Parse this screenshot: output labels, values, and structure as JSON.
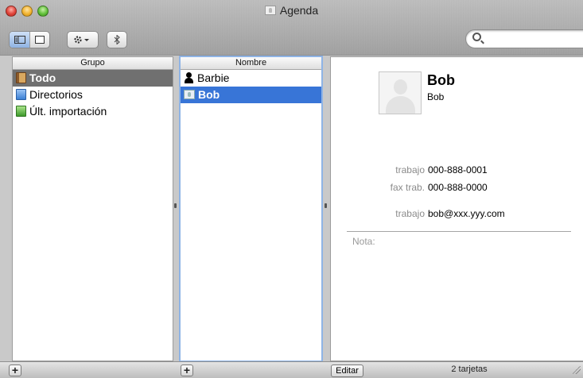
{
  "window": {
    "title": "Agenda"
  },
  "toolbar": {
    "view_columns_icon": "columns-view-icon",
    "view_card_icon": "card-view-icon",
    "action_icon": "gear-menu-icon",
    "bluetooth_icon": "bluetooth-icon",
    "search_placeholder": "",
    "search_value": ""
  },
  "groups": {
    "header": "Grupo",
    "items": [
      {
        "label": "Todo",
        "icon": "address-book-icon",
        "selected": true
      },
      {
        "label": "Directorios",
        "icon": "directory-icon",
        "selected": false
      },
      {
        "label": "Últ. importación",
        "icon": "last-import-icon",
        "selected": false
      }
    ]
  },
  "names": {
    "header": "Nombre",
    "items": [
      {
        "label": "Barbie",
        "icon": "person-icon",
        "selected": false
      },
      {
        "label": "Bob",
        "icon": "me-card-icon",
        "selected": true
      }
    ]
  },
  "card": {
    "name": "Bob",
    "company": "Bob",
    "fields": [
      {
        "label": "trabajo",
        "value": "000-888-0001"
      },
      {
        "label": "fax trab.",
        "value": "000-888-0000"
      },
      {
        "label": "trabajo",
        "value": "bob@xxx.yyy.com"
      }
    ],
    "note_label": "Nota:"
  },
  "bottom": {
    "add_symbol": "+",
    "edit_label": "Editar",
    "count": "2 tarjetas"
  },
  "colors": {
    "selection_blue": "#3875d7",
    "group_selection_gray": "#707070",
    "field_label_gray": "#8b8b8b"
  }
}
